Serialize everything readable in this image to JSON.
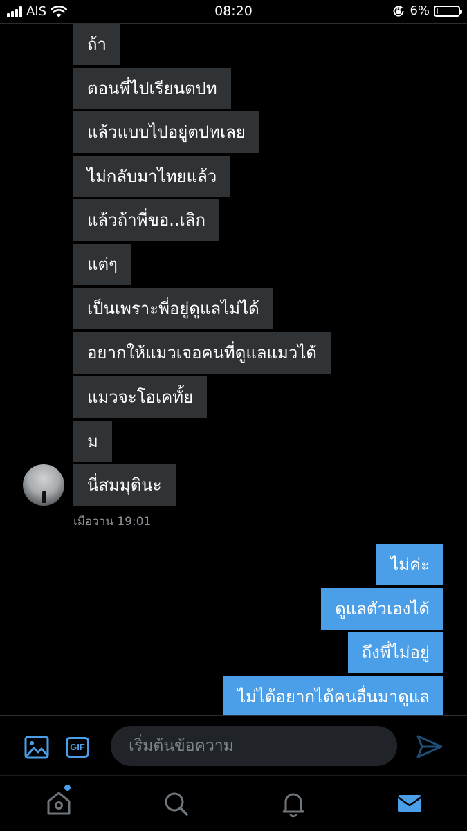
{
  "status_bar": {
    "carrier": "AIS",
    "time": "08:20",
    "battery_percent": "6%",
    "battery_level": 0.06,
    "icons": [
      "signal-bars-icon",
      "wifi-icon",
      "rotation-lock-icon",
      "battery-icon"
    ]
  },
  "conversation": {
    "incoming": [
      "ถ้า",
      "ตอนพี่ไปเรียนตปท",
      "แล้วแบบไปอยู่ตปทเลย",
      "ไม่กลับมาไทยแล้ว",
      "แล้วถ้าพี่ขอ..เลิก",
      "แต่ๆ",
      "เป็นเพราะพี่อยู่ดูแลไม่ได้",
      "อยากให้แมวเจอคนที่ดูแลแมวได้",
      "แมวจะโอเคทั้ย",
      "ม",
      "นี่สมมุตินะ"
    ],
    "incoming_timestamp": "เมือวาน 19:01",
    "outgoing": [
      "ไม่ค่ะ",
      "ดูแลตัวเองได้",
      "ถึงพี่ไม่อยู่",
      "ไม่ได้อยากได้คนอื่นมาดูแล"
    ]
  },
  "composer": {
    "gif_label": "GIF",
    "placeholder": "เริ่มต้นข้อความ",
    "value": "",
    "icons": [
      "image-icon",
      "gif-icon",
      "send-icon"
    ]
  },
  "tab_bar": {
    "tabs": [
      "home-icon",
      "search-icon",
      "bell-icon",
      "mail-icon"
    ],
    "active_tab": "mail-icon"
  },
  "colors": {
    "background": "#000000",
    "incoming_bubble": "#2f3336",
    "outgoing_bubble": "#4a9fe8",
    "accent": "#4a9fe8",
    "muted_text": "#8b9196"
  }
}
